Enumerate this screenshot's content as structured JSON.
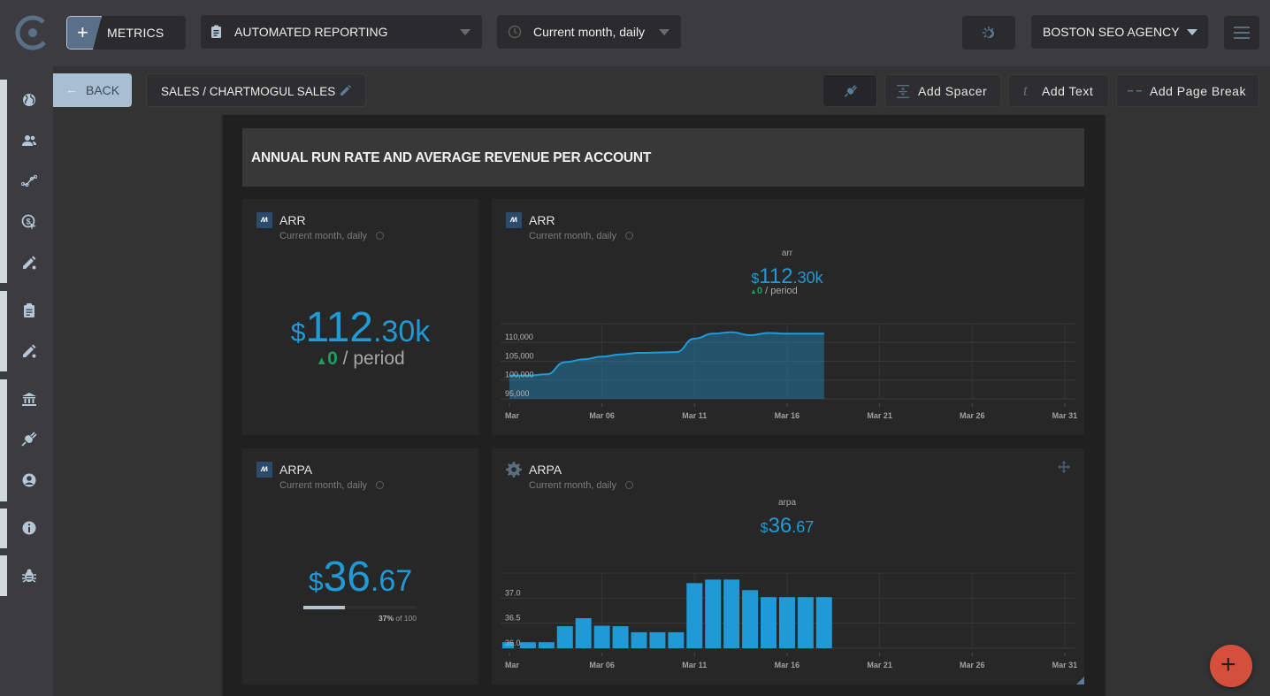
{
  "topbar": {
    "metrics_label": "METRICS",
    "report_dropdown": "AUTOMATED REPORTING",
    "period_dropdown": "Current month, daily",
    "agency_dropdown": "BOSTON SEO AGENCY"
  },
  "sidebar": {
    "icons": [
      "globe-icon",
      "users-icon",
      "chart-line-icon",
      "target-dollar-icon",
      "edit-pen-icon",
      "clipboard-icon",
      "edit-pen-icon",
      "bank-icon",
      "plug-icon",
      "user-circle-icon",
      "info-icon",
      "bug-icon"
    ]
  },
  "toolbar": {
    "back_label": "BACK",
    "breadcrumb": "SALES / CHARTMOGUL SALES",
    "add_spacer": "Add Spacer",
    "add_text": "Add Text",
    "add_page_break": "Add Page Break"
  },
  "section": {
    "title": "ANNUAL RUN RATE AND AVERAGE REVENUE PER ACCOUNT"
  },
  "cards": {
    "arr_single": {
      "title": "ARR",
      "subtitle": "Current month, daily",
      "currency": "$",
      "value_main": "112",
      "value_decimal": ".30k",
      "delta_arrow": "▲",
      "delta_value": "0",
      "delta_suffix": " / period"
    },
    "arr_chart": {
      "title": "ARR",
      "subtitle": "Current month, daily",
      "series_label": "arr",
      "currency": "$",
      "value_main": "112",
      "value_decimal": ".30k",
      "delta_arrow": "▲",
      "delta_value": "0",
      "delta_suffix": " / period"
    },
    "arpa_single": {
      "title": "ARPA",
      "subtitle": "Current month, daily",
      "currency": "$",
      "value_main": "36",
      "value_decimal": ".67",
      "progress_percent": 37,
      "progress_pct_label": "37%",
      "progress_of_label": " of 100"
    },
    "arpa_chart": {
      "title": "ARPA",
      "subtitle": "Current month, daily",
      "series_label": "arpa",
      "currency": "$",
      "value_main": "36",
      "value_decimal": ".67"
    }
  },
  "chart_data": [
    {
      "type": "area",
      "title": "arr",
      "xlabel": "",
      "ylabel": "",
      "x": [
        "Mar 01",
        "Mar 02",
        "Mar 03",
        "Mar 04",
        "Mar 05",
        "Mar 06",
        "Mar 07",
        "Mar 08",
        "Mar 09",
        "Mar 10",
        "Mar 11",
        "Mar 12",
        "Mar 13",
        "Mar 14",
        "Mar 15",
        "Mar 16",
        "Mar 17",
        "Mar 18"
      ],
      "values": [
        101200,
        101200,
        101500,
        104700,
        105500,
        106200,
        106800,
        107200,
        107300,
        107400,
        111000,
        112300,
        112700,
        111900,
        112500,
        112300,
        112300,
        112300
      ],
      "x_range": [
        "Mar 01",
        "Mar 31"
      ],
      "x_ticks": [
        "Mar",
        "Mar 06",
        "Mar 11",
        "Mar 16",
        "Mar 21",
        "Mar 26",
        "Mar 31"
      ],
      "y_ticks": [
        "95,000",
        "100,000",
        "105,000",
        "110,000"
      ],
      "ylim": [
        95000,
        113500
      ],
      "grid": true,
      "color": "#1f9ad6"
    },
    {
      "type": "bar",
      "title": "arpa",
      "xlabel": "",
      "ylabel": "",
      "x": [
        "Mar 01",
        "Mar 02",
        "Mar 03",
        "Mar 04",
        "Mar 05",
        "Mar 06",
        "Mar 07",
        "Mar 08",
        "Mar 09",
        "Mar 10",
        "Mar 11",
        "Mar 12",
        "Mar 13",
        "Mar 14",
        "Mar 15",
        "Mar 16",
        "Mar 17",
        "Mar 18"
      ],
      "values": [
        36.12,
        36.12,
        36.12,
        36.44,
        36.6,
        36.45,
        36.44,
        36.32,
        36.32,
        36.32,
        37.3,
        37.37,
        37.37,
        37.16,
        37.02,
        37.02,
        37.02,
        37.02
      ],
      "x_range": [
        "Mar 01",
        "Mar 31"
      ],
      "x_ticks": [
        "Mar",
        "Mar 06",
        "Mar 11",
        "Mar 16",
        "Mar 21",
        "Mar 26",
        "Mar 31"
      ],
      "y_ticks": [
        "36.0",
        "36.5",
        "37.0"
      ],
      "ylim": [
        36.0,
        37.5
      ],
      "grid": true,
      "color": "#1f9ad6"
    }
  ]
}
